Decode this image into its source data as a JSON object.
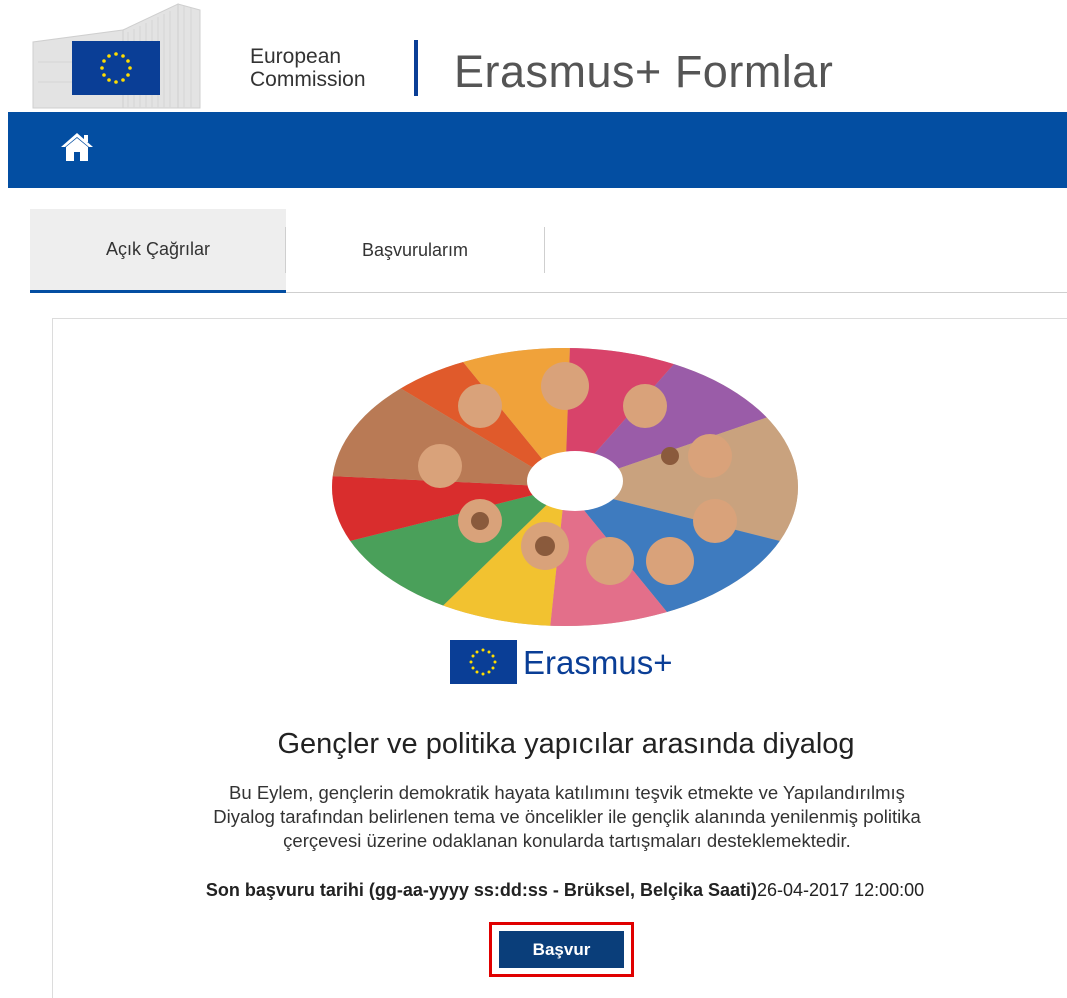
{
  "header": {
    "org_line1": "European",
    "org_line2": "Commission",
    "app_title": "Erasmus+ Formlar",
    "icons": {
      "logo": "eu-flag-icon",
      "building": "berlaymont-building-icon"
    }
  },
  "navbar": {
    "home_icon": "home-icon",
    "color": "#034ea2"
  },
  "tabs": [
    {
      "label": "Açık Çağrılar",
      "active": true
    },
    {
      "label": "Başvurularım",
      "active": false
    }
  ],
  "call": {
    "logo_text": "Erasmus+",
    "title": "Gençler ve politika yapıcılar arasında diyalog",
    "description_lines": [
      "Bu Eylem, gençlerin demokratik hayata katılımını teşvik etmekte ve Yapılandırılmış",
      "Diyalog tarafından belirlenen tema ve öncelikler ile gençlik alanında yenilenmiş politika",
      "çerçevesi üzerine odaklanan konularda tartışmaları desteklemektedir."
    ],
    "deadline_label": "Son başvuru tarihi (gg-aa-yyyy ss:dd:ss - Brüksel, Belçika Saati)",
    "deadline_value": "26-04-2017 12:00:00",
    "apply_label": "Başvur"
  },
  "colors": {
    "brand_blue": "#034ea2",
    "eu_flag_blue": "#0a3e96",
    "highlight_red": "#e00000"
  }
}
